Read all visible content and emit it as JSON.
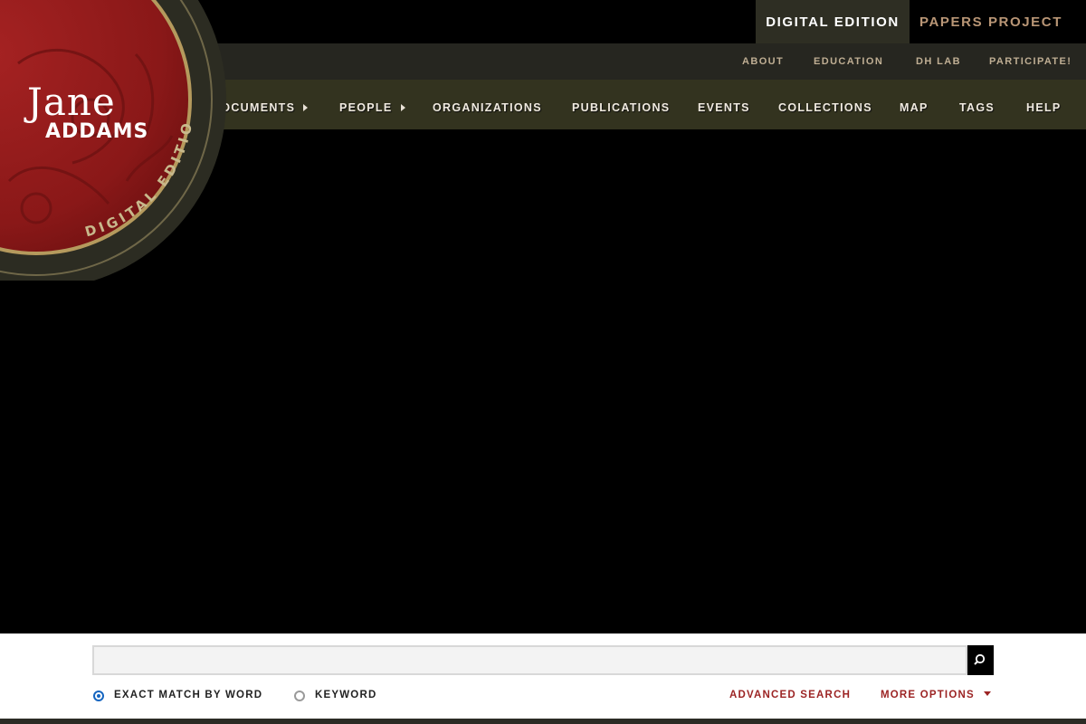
{
  "topbar": {
    "tabs": [
      {
        "label": "DIGITAL EDITION",
        "active": true
      },
      {
        "label": "PAPERS PROJECT",
        "active": false
      }
    ]
  },
  "secondary_nav": {
    "items": [
      "ABOUT",
      "EDUCATION",
      "DH LAB",
      "PARTICIPATE!"
    ]
  },
  "main_nav": {
    "items": [
      {
        "label": "DOCUMENTS",
        "has_submenu": true
      },
      {
        "label": "PEOPLE",
        "has_submenu": true
      },
      {
        "label": "ORGANIZATIONS",
        "has_submenu": false
      },
      {
        "label": "PUBLICATIONS",
        "has_submenu": false
      },
      {
        "label": "EVENTS",
        "has_submenu": false
      },
      {
        "label": "COLLECTIONS",
        "has_submenu": false
      },
      {
        "label": "MAP",
        "has_submenu": false
      },
      {
        "label": "TAGS",
        "has_submenu": false
      },
      {
        "label": "HELP",
        "has_submenu": false
      }
    ]
  },
  "logo": {
    "line1": "Jane",
    "line2": "ADDAMS",
    "arc_text": "DIGITAL EDITION"
  },
  "search": {
    "value": "",
    "placeholder": "",
    "button_icon": "search-icon",
    "options": [
      {
        "label": "EXACT MATCH BY WORD",
        "selected": true
      },
      {
        "label": "KEYWORD",
        "selected": false
      }
    ],
    "advanced_label": "ADVANCED SEARCH",
    "more_options_label": "MORE OPTIONS"
  },
  "colors": {
    "background": "#000000",
    "topbar_active": "#2e2e23",
    "tab_inactive_text": "#b99676",
    "nav_band": "#33331f",
    "logo_red": "#8e1b1b",
    "accent_link": "#9c2424",
    "radio_selected": "#1565c0"
  }
}
